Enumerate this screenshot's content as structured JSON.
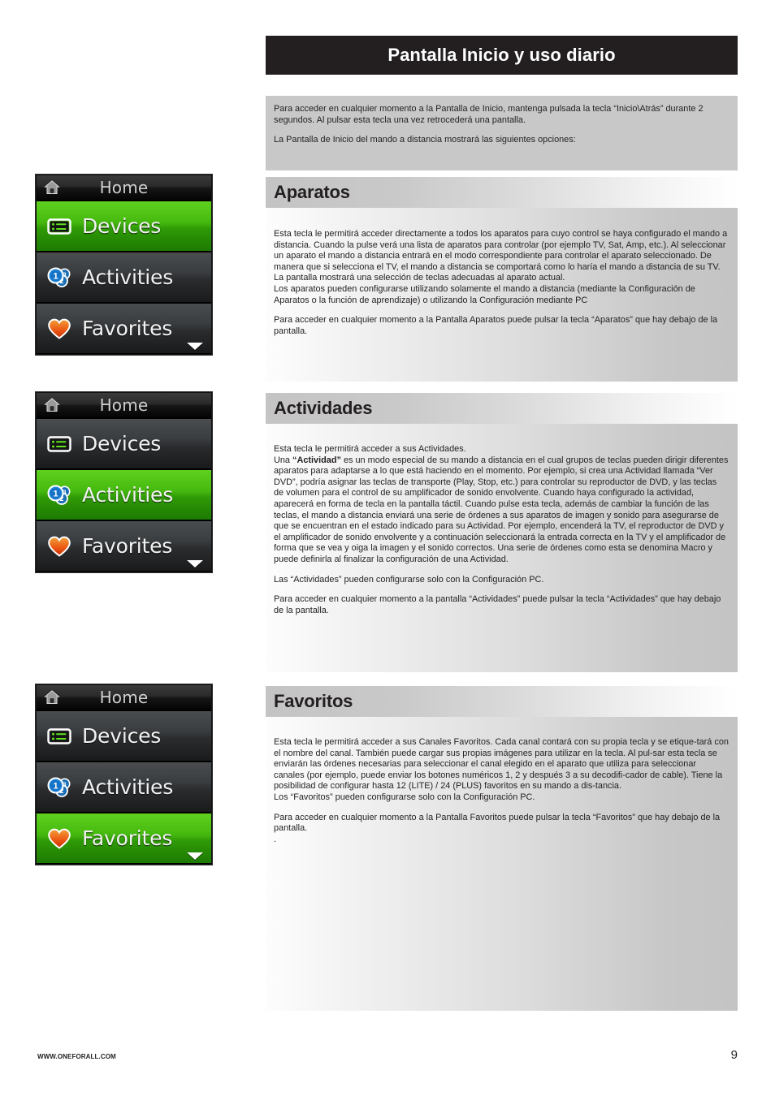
{
  "page": {
    "title": "Pantalla Inicio y uso diario",
    "number": "9",
    "footer_url": "WWW.ONEFORALL.COM"
  },
  "intro": {
    "p1": "Para acceder en cualquier momento a la Pantalla de Inicio, mantenga pulsada la tecla “Inicio\\Atrás” durante 2 segundos.  Al pulsar esta tecla una vez retrocederá una pantalla.",
    "p2": "La Pantalla de Inicio del mando a distancia mostrará las siguientes opciones:"
  },
  "sections": [
    {
      "heading": "Aparatos",
      "p1": "Esta tecla le permitirá acceder directamente a todos los aparatos para cuyo control se haya configurado el mando a distancia. Cuando la pulse verá una lista de aparatos para controlar (por ejemplo TV, Sat, Amp, etc.). Al seleccionar un aparato el mando a distancia entrará en el modo correspondiente para controlar el aparato seleccionado. De manera que si selecciona el TV, el mando a distancia se comportará como lo haría el mando a distancia de su TV.",
      "p2": "La pantalla mostrará una selección de teclas adecuadas al aparato actual.",
      "p3": "Los aparatos pueden configurarse utilizando solamente el mando a distancia (mediante la Configuración de Aparatos o la función de aprendizaje) o utilizando la Configuración mediante PC",
      "p4": "Para acceder en cualquier momento a la Pantalla Aparatos puede pulsar la tecla “Aparatos” que hay debajo de la pantalla."
    },
    {
      "heading": "Actividades",
      "p1": "Esta tecla le permitirá acceder a sus Actividades.",
      "p2_pre": "Una ",
      "p2_bold": "“Actividad”",
      "p2_post": " es un modo especial de su mando a distancia en el cual grupos de teclas pueden dirigir diferentes aparatos para adaptarse a lo que está haciendo en el momento. Por ejemplo, si crea una Actividad llamada “Ver DVD”, podría asignar las teclas  de transporte (Play, Stop, etc.) para controlar su reproductor de DVD, y las teclas de volumen para el control de su amplificador de sonido envolvente. Cuando haya configurado la actividad, aparecerá en forma de tecla en la pantalla táctil. Cuando pulse esta tecla, además de cambiar la función de las teclas, el mando a distancia enviará una serie de órdenes a sus aparatos de imagen y sonido para asegurarse de que se encuentran en el estado indicado para su Actividad. Por ejemplo, encenderá la TV, el reproductor de DVD y el amplificador de sonido envolvente y a continuación seleccionará la entrada correcta en la TV y el amplificador de forma que se vea y oiga la imagen y el sonido correctos. Una serie de órdenes como esta se denomina Macro y puede definirla al finalizar la configuración de una Actividad.",
      "p3": "Las “Actividades” pueden configurarse solo con la Configuración PC.",
      "p4": "Para acceder en cualquier momento a la pantalla “Actividades” puede pulsar la tecla “Actividades” que hay debajo de la pantalla."
    },
    {
      "heading": "Favoritos",
      "p1": "Esta tecla le permitirá acceder a sus Canales Favoritos. Cada canal contará con su propia tecla y se etique-tará con el nombre del canal. También puede cargar sus propias imágenes para utilizar en la tecla. Al pul-sar esta tecla se enviarán las órdenes necesarias para seleccionar el canal elegido en el aparato que utiliza para seleccionar canales (por ejemplo, puede enviar los botones numéricos 1, 2 y después 3 a su decodifi-cador de cable). Tiene la posibilidad de configurar hasta 12 (LITE) / 24 (PLUS) favoritos en su mando a dis-tancia.",
      "p2": "Los “Favoritos” pueden configurarse solo con la Configuración PC.",
      "p3": "Para acceder en cualquier momento a la Pantalla Favoritos puede pulsar la tecla “Favoritos” que hay debajo de la pantalla.",
      "p4": "."
    }
  ],
  "screens": [
    {
      "titlebar": "Home",
      "rows": [
        {
          "label": "Devices",
          "icon": "devices-icon",
          "active": true
        },
        {
          "label": "Activities",
          "icon": "activities-icon",
          "active": false
        },
        {
          "label": "Favorites",
          "icon": "favorites-heart-icon",
          "active": false
        }
      ]
    },
    {
      "titlebar": "Home",
      "rows": [
        {
          "label": "Devices",
          "icon": "devices-icon",
          "active": false
        },
        {
          "label": "Activities",
          "icon": "activities-icon",
          "active": true
        },
        {
          "label": "Favorites",
          "icon": "favorites-heart-icon",
          "active": false
        }
      ]
    },
    {
      "titlebar": "Home",
      "rows": [
        {
          "label": "Devices",
          "icon": "devices-icon",
          "active": false
        },
        {
          "label": "Activities",
          "icon": "activities-icon",
          "active": false
        },
        {
          "label": "Favorites",
          "icon": "favorites-heart-icon",
          "active": true
        }
      ]
    }
  ],
  "colors": {
    "accent_green": "#46b90f",
    "title_bar": "#231f20",
    "panel_gray": "#c8c8c8",
    "heart_orange": "#e8601b"
  }
}
